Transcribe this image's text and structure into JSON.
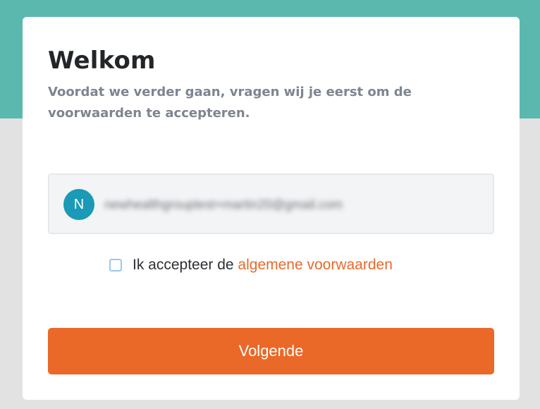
{
  "welcome": {
    "title": "Welkom",
    "subtitle": "Voordat we verder gaan, vragen wij je eerst om de voorwaarden te accepteren."
  },
  "account": {
    "avatar_initial": "N",
    "email": "newhealthgrouptest+martin20@gmail.com"
  },
  "consent": {
    "checked": false,
    "text": "Ik accepteer de ",
    "link_text": "algemene voorwaarden"
  },
  "actions": {
    "next_label": "Volgende"
  },
  "colors": {
    "header_band": "#5bb8ae",
    "accent": "#ea6828",
    "avatar": "#1a9ab6"
  }
}
